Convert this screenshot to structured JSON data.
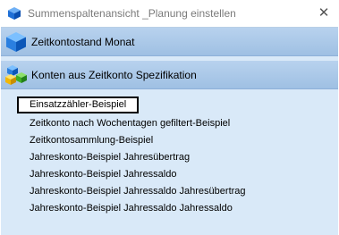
{
  "window": {
    "title": "Summenspaltenansicht _Planung einstellen",
    "close_glyph": "✕"
  },
  "panel": {
    "band1_label": "Zeitkontostand Monat",
    "band2_label": "Konten aus Zeitkonto Spezifikation"
  },
  "items": [
    {
      "label": "Einsatzzähler-Beispiel"
    },
    {
      "label": "Zeitkonto nach Wochentagen gefiltert-Beispiel"
    },
    {
      "label": "Zeitkontosammlung-Beispiel"
    },
    {
      "label": "Jahreskonto-Beispiel Jahresübertrag"
    },
    {
      "label": "Jahreskonto-Beispiel Jahressaldo"
    },
    {
      "label": "Jahreskonto-Beispiel Jahressaldo Jahresübertrag"
    },
    {
      "label": "Jahreskonto-Beispiel Jahressaldo Jahressaldo"
    }
  ],
  "icons": {
    "app": "blue-cube-icon",
    "band1": "blue-cube-icon",
    "band2": "colored-cubes-icon"
  }
}
